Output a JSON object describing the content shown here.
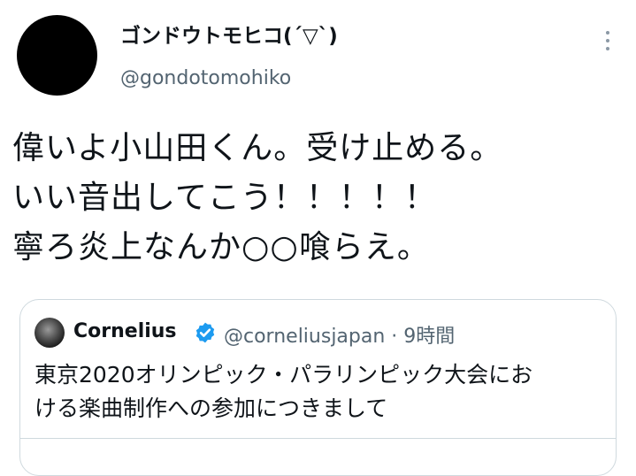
{
  "tweet": {
    "display_name": "ゴンドウトモヒコ(´▽`)",
    "username": "@gondotomohiko",
    "more_icon": "more-vertical-icon",
    "text_lines": [
      "偉いよ小山田くん。受け止める。",
      "いい音出してこう！！！！！",
      "寧ろ炎上なんか○○喰らえ。"
    ]
  },
  "quoted_tweet": {
    "name": "Cornelius",
    "verified_icon": "verified-badge-icon",
    "handle_time": "@corneliusjapan · 9時間",
    "text_lines": [
      "東京2020オリンピック・パラリンピック大会にお",
      "ける楽曲制作への参加につきまして"
    ]
  },
  "colors": {
    "text": "#0f1419",
    "secondary": "#536471",
    "border": "#cfd9de",
    "verified": "#1d9bf0"
  }
}
